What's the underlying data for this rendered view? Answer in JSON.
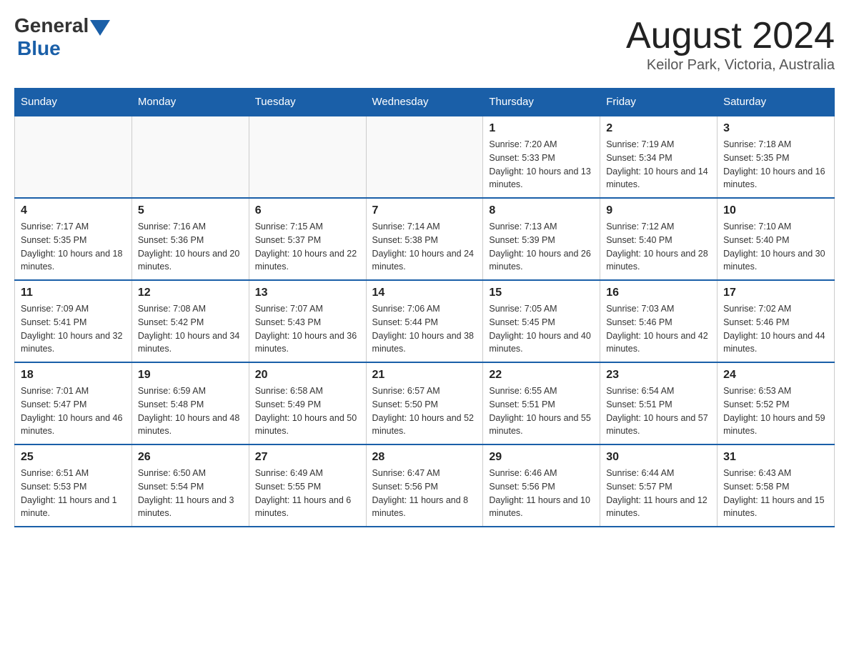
{
  "logo": {
    "general": "General",
    "blue": "Blue"
  },
  "title": "August 2024",
  "location": "Keilor Park, Victoria, Australia",
  "days_of_week": [
    "Sunday",
    "Monday",
    "Tuesday",
    "Wednesday",
    "Thursday",
    "Friday",
    "Saturday"
  ],
  "weeks": [
    [
      {
        "day": "",
        "info": ""
      },
      {
        "day": "",
        "info": ""
      },
      {
        "day": "",
        "info": ""
      },
      {
        "day": "",
        "info": ""
      },
      {
        "day": "1",
        "info": "Sunrise: 7:20 AM\nSunset: 5:33 PM\nDaylight: 10 hours and 13 minutes."
      },
      {
        "day": "2",
        "info": "Sunrise: 7:19 AM\nSunset: 5:34 PM\nDaylight: 10 hours and 14 minutes."
      },
      {
        "day": "3",
        "info": "Sunrise: 7:18 AM\nSunset: 5:35 PM\nDaylight: 10 hours and 16 minutes."
      }
    ],
    [
      {
        "day": "4",
        "info": "Sunrise: 7:17 AM\nSunset: 5:35 PM\nDaylight: 10 hours and 18 minutes."
      },
      {
        "day": "5",
        "info": "Sunrise: 7:16 AM\nSunset: 5:36 PM\nDaylight: 10 hours and 20 minutes."
      },
      {
        "day": "6",
        "info": "Sunrise: 7:15 AM\nSunset: 5:37 PM\nDaylight: 10 hours and 22 minutes."
      },
      {
        "day": "7",
        "info": "Sunrise: 7:14 AM\nSunset: 5:38 PM\nDaylight: 10 hours and 24 minutes."
      },
      {
        "day": "8",
        "info": "Sunrise: 7:13 AM\nSunset: 5:39 PM\nDaylight: 10 hours and 26 minutes."
      },
      {
        "day": "9",
        "info": "Sunrise: 7:12 AM\nSunset: 5:40 PM\nDaylight: 10 hours and 28 minutes."
      },
      {
        "day": "10",
        "info": "Sunrise: 7:10 AM\nSunset: 5:40 PM\nDaylight: 10 hours and 30 minutes."
      }
    ],
    [
      {
        "day": "11",
        "info": "Sunrise: 7:09 AM\nSunset: 5:41 PM\nDaylight: 10 hours and 32 minutes."
      },
      {
        "day": "12",
        "info": "Sunrise: 7:08 AM\nSunset: 5:42 PM\nDaylight: 10 hours and 34 minutes."
      },
      {
        "day": "13",
        "info": "Sunrise: 7:07 AM\nSunset: 5:43 PM\nDaylight: 10 hours and 36 minutes."
      },
      {
        "day": "14",
        "info": "Sunrise: 7:06 AM\nSunset: 5:44 PM\nDaylight: 10 hours and 38 minutes."
      },
      {
        "day": "15",
        "info": "Sunrise: 7:05 AM\nSunset: 5:45 PM\nDaylight: 10 hours and 40 minutes."
      },
      {
        "day": "16",
        "info": "Sunrise: 7:03 AM\nSunset: 5:46 PM\nDaylight: 10 hours and 42 minutes."
      },
      {
        "day": "17",
        "info": "Sunrise: 7:02 AM\nSunset: 5:46 PM\nDaylight: 10 hours and 44 minutes."
      }
    ],
    [
      {
        "day": "18",
        "info": "Sunrise: 7:01 AM\nSunset: 5:47 PM\nDaylight: 10 hours and 46 minutes."
      },
      {
        "day": "19",
        "info": "Sunrise: 6:59 AM\nSunset: 5:48 PM\nDaylight: 10 hours and 48 minutes."
      },
      {
        "day": "20",
        "info": "Sunrise: 6:58 AM\nSunset: 5:49 PM\nDaylight: 10 hours and 50 minutes."
      },
      {
        "day": "21",
        "info": "Sunrise: 6:57 AM\nSunset: 5:50 PM\nDaylight: 10 hours and 52 minutes."
      },
      {
        "day": "22",
        "info": "Sunrise: 6:55 AM\nSunset: 5:51 PM\nDaylight: 10 hours and 55 minutes."
      },
      {
        "day": "23",
        "info": "Sunrise: 6:54 AM\nSunset: 5:51 PM\nDaylight: 10 hours and 57 minutes."
      },
      {
        "day": "24",
        "info": "Sunrise: 6:53 AM\nSunset: 5:52 PM\nDaylight: 10 hours and 59 minutes."
      }
    ],
    [
      {
        "day": "25",
        "info": "Sunrise: 6:51 AM\nSunset: 5:53 PM\nDaylight: 11 hours and 1 minute."
      },
      {
        "day": "26",
        "info": "Sunrise: 6:50 AM\nSunset: 5:54 PM\nDaylight: 11 hours and 3 minutes."
      },
      {
        "day": "27",
        "info": "Sunrise: 6:49 AM\nSunset: 5:55 PM\nDaylight: 11 hours and 6 minutes."
      },
      {
        "day": "28",
        "info": "Sunrise: 6:47 AM\nSunset: 5:56 PM\nDaylight: 11 hours and 8 minutes."
      },
      {
        "day": "29",
        "info": "Sunrise: 6:46 AM\nSunset: 5:56 PM\nDaylight: 11 hours and 10 minutes."
      },
      {
        "day": "30",
        "info": "Sunrise: 6:44 AM\nSunset: 5:57 PM\nDaylight: 11 hours and 12 minutes."
      },
      {
        "day": "31",
        "info": "Sunrise: 6:43 AM\nSunset: 5:58 PM\nDaylight: 11 hours and 15 minutes."
      }
    ]
  ]
}
